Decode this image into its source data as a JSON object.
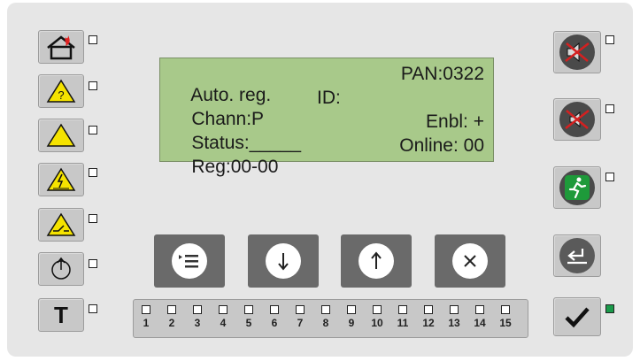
{
  "display": {
    "row1_left": "Auto. reg.",
    "row1_right": "PAN:0322",
    "row2_left": "Chann:P",
    "row2_mid": "ID:",
    "row3_left": "Status:_____",
    "row3_right": "Enbl: +",
    "row4_left": "Reg:00-00",
    "row4_right": "Online: 00"
  },
  "left_buttons": [
    {
      "icon": "fire-house-icon"
    },
    {
      "icon": "unknown-warning-icon"
    },
    {
      "icon": "warning-icon"
    },
    {
      "icon": "electrical-fault-icon"
    },
    {
      "icon": "disabled-icon"
    },
    {
      "icon": "power-icon"
    },
    {
      "label": "T",
      "icon": "test-icon"
    }
  ],
  "nav_buttons": [
    {
      "icon": "menu-icon"
    },
    {
      "icon": "arrow-down-icon"
    },
    {
      "icon": "arrow-up-icon"
    },
    {
      "icon": "close-icon"
    }
  ],
  "right_buttons": [
    {
      "icon": "sound-off-icon"
    },
    {
      "icon": "buzzer-off-icon"
    },
    {
      "icon": "evacuation-icon"
    },
    {
      "icon": "back-icon"
    },
    {
      "icon": "confirm-check-icon",
      "led_on": true
    }
  ],
  "zones": [
    "1",
    "2",
    "3",
    "4",
    "5",
    "6",
    "7",
    "8",
    "9",
    "10",
    "11",
    "12",
    "13",
    "14",
    "15"
  ],
  "colors": {
    "lcd": "#a8c98a",
    "warning_yellow": "#f5e300",
    "fire_red": "#e02020",
    "mute_red": "#d42020",
    "exit_green": "#1e9a3a",
    "led_green": "#1a9a4a"
  }
}
